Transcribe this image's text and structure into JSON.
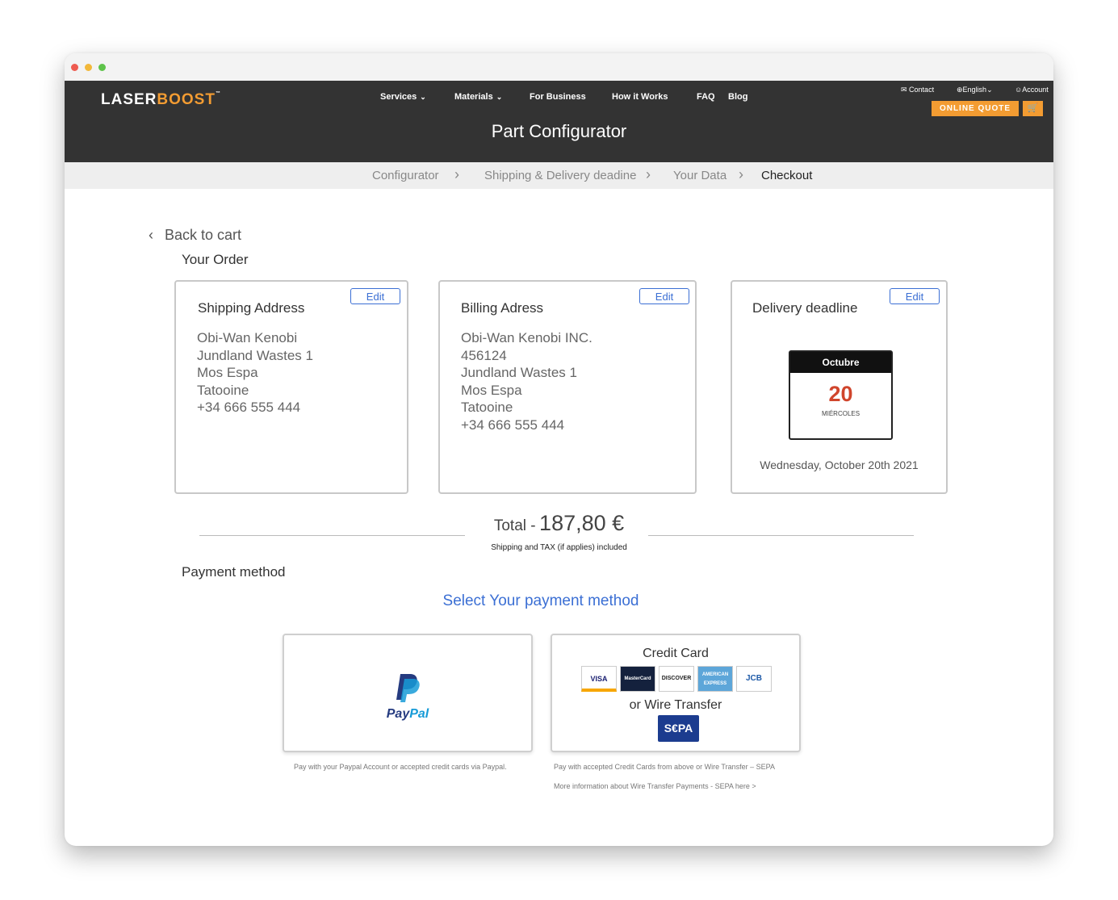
{
  "brand": {
    "logo_main": "LASER",
    "logo_accent": "BOOST",
    "logo_mark": "™"
  },
  "nav": {
    "items": [
      "Services",
      "Materials",
      "For Business",
      "How it Works",
      "FAQ",
      "Blog"
    ],
    "contact": "Contact",
    "language": "English",
    "account": "Account",
    "online_quote": "ONLINE QUOTE"
  },
  "page_title": "Part Configurator",
  "steps": [
    "Configurator",
    "Shipping & Delivery deadine",
    "Your Data",
    "Checkout"
  ],
  "back_link": "Back to cart",
  "your_order": "Your Order",
  "edit_label": "Edit",
  "shipping": {
    "title": "Shipping Address",
    "lines": [
      "Obi-Wan Kenobi",
      "Jundland Wastes 1",
      "Mos Espa",
      "Tatooine",
      "+34 666 555 444"
    ]
  },
  "billing": {
    "title": "Billing Adress",
    "lines": [
      "Obi-Wan Kenobi INC.",
      "456124",
      "Jundland Wastes 1",
      "Mos Espa",
      "Tatooine",
      "+34 666 555 444"
    ]
  },
  "delivery": {
    "title": "Delivery deadline",
    "month": "Octubre",
    "day": "20",
    "weekday": "MIÉRCOLES",
    "full_date": "Wednesday, October 20th 2021"
  },
  "total": {
    "label": "Total -",
    "amount": "187,80 €",
    "note": "Shipping and TAX (if applies) included"
  },
  "payment": {
    "section": "Payment method",
    "select": "Select Your payment method",
    "paypal_word_a": "Pay",
    "paypal_word_b": "Pal",
    "paypal_note": "Pay with your Paypal Account or accepted credit cards via Paypal.",
    "credit_card": "Credit Card",
    "cards": [
      "VISA",
      "MasterCard",
      "DISCOVER",
      "AMERICAN EXPRESS",
      "JCB"
    ],
    "wire": "or Wire Transfer",
    "sepa": "S€PA",
    "cc_note": "Pay with accepted Credit Cards from above or Wire Transfer – SEPA",
    "sepa_note": "More information about Wire Transfer Payments - SEPA here >"
  },
  "colors": {
    "header": "#333333",
    "accent": "#f39c32",
    "link": "#3b6fd4",
    "calendar_day": "#d0452c"
  }
}
